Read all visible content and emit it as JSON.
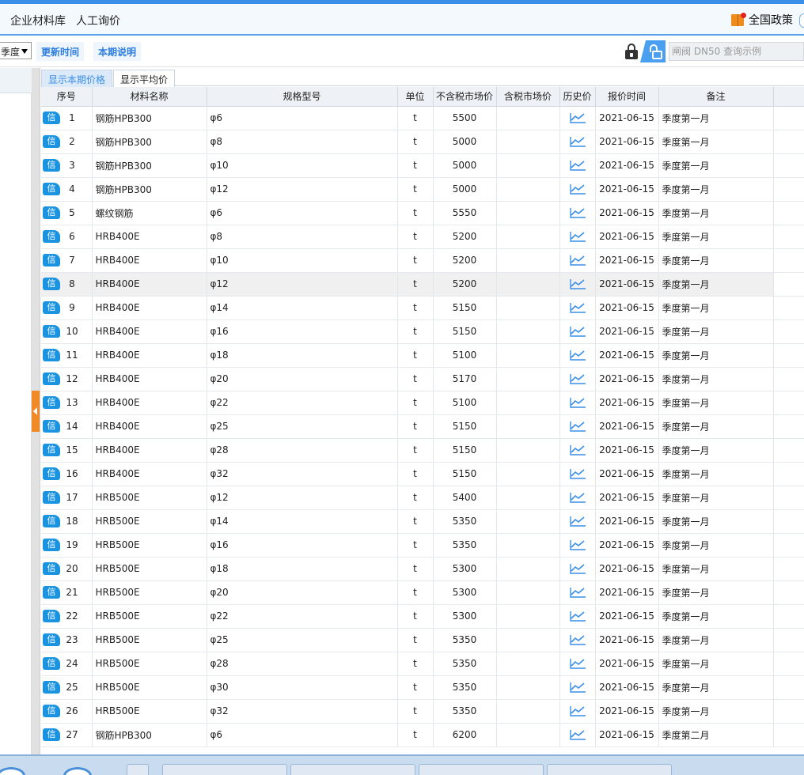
{
  "menu": {
    "item1": "企业材料库",
    "item2": "人工询价",
    "policy": "全国政策"
  },
  "toolbar": {
    "select_value": "季度",
    "update_time": "更新时间",
    "period_note": "本期说明",
    "search_placeholder": "闸阀 DN50 查询示例"
  },
  "tabs": {
    "current": "显示本期价格",
    "average": "显示平均价"
  },
  "columns": {
    "seq": "序号",
    "name": "材料名称",
    "spec": "规格型号",
    "unit": "单位",
    "price_ex": "不含税市场价",
    "price_in": "含税市场价",
    "history": "历史价",
    "date": "报价时间",
    "remark": "备注"
  },
  "badge_label": "信",
  "highlighted_row": 8,
  "rows": [
    {
      "seq": "1",
      "name": "钢筋HPB300",
      "spec": "φ6",
      "unit": "t",
      "price_ex": "5500",
      "price_in": "",
      "date": "2021-06-15",
      "remark": "季度第一月"
    },
    {
      "seq": "2",
      "name": "钢筋HPB300",
      "spec": "φ8",
      "unit": "t",
      "price_ex": "5000",
      "price_in": "",
      "date": "2021-06-15",
      "remark": "季度第一月"
    },
    {
      "seq": "3",
      "name": "钢筋HPB300",
      "spec": "φ10",
      "unit": "t",
      "price_ex": "5000",
      "price_in": "",
      "date": "2021-06-15",
      "remark": "季度第一月"
    },
    {
      "seq": "4",
      "name": "钢筋HPB300",
      "spec": "φ12",
      "unit": "t",
      "price_ex": "5000",
      "price_in": "",
      "date": "2021-06-15",
      "remark": "季度第一月"
    },
    {
      "seq": "5",
      "name": "螺纹钢筋",
      "spec": "φ6",
      "unit": "t",
      "price_ex": "5550",
      "price_in": "",
      "date": "2021-06-15",
      "remark": "季度第一月"
    },
    {
      "seq": "6",
      "name": "HRB400E",
      "spec": "φ8",
      "unit": "t",
      "price_ex": "5200",
      "price_in": "",
      "date": "2021-06-15",
      "remark": "季度第一月"
    },
    {
      "seq": "7",
      "name": "HRB400E",
      "spec": "φ10",
      "unit": "t",
      "price_ex": "5200",
      "price_in": "",
      "date": "2021-06-15",
      "remark": "季度第一月"
    },
    {
      "seq": "8",
      "name": "HRB400E",
      "spec": "φ12",
      "unit": "t",
      "price_ex": "5200",
      "price_in": "",
      "date": "2021-06-15",
      "remark": "季度第一月"
    },
    {
      "seq": "9",
      "name": "HRB400E",
      "spec": "φ14",
      "unit": "t",
      "price_ex": "5150",
      "price_in": "",
      "date": "2021-06-15",
      "remark": "季度第一月"
    },
    {
      "seq": "10",
      "name": "HRB400E",
      "spec": "φ16",
      "unit": "t",
      "price_ex": "5150",
      "price_in": "",
      "date": "2021-06-15",
      "remark": "季度第一月"
    },
    {
      "seq": "11",
      "name": "HRB400E",
      "spec": "φ18",
      "unit": "t",
      "price_ex": "5100",
      "price_in": "",
      "date": "2021-06-15",
      "remark": "季度第一月"
    },
    {
      "seq": "12",
      "name": "HRB400E",
      "spec": "φ20",
      "unit": "t",
      "price_ex": "5170",
      "price_in": "",
      "date": "2021-06-15",
      "remark": "季度第一月"
    },
    {
      "seq": "13",
      "name": "HRB400E",
      "spec": "φ22",
      "unit": "t",
      "price_ex": "5100",
      "price_in": "",
      "date": "2021-06-15",
      "remark": "季度第一月"
    },
    {
      "seq": "14",
      "name": "HRB400E",
      "spec": "φ25",
      "unit": "t",
      "price_ex": "5150",
      "price_in": "",
      "date": "2021-06-15",
      "remark": "季度第一月"
    },
    {
      "seq": "15",
      "name": "HRB400E",
      "spec": "φ28",
      "unit": "t",
      "price_ex": "5150",
      "price_in": "",
      "date": "2021-06-15",
      "remark": "季度第一月"
    },
    {
      "seq": "16",
      "name": "HRB400E",
      "spec": "φ32",
      "unit": "t",
      "price_ex": "5150",
      "price_in": "",
      "date": "2021-06-15",
      "remark": "季度第一月"
    },
    {
      "seq": "17",
      "name": "HRB500E",
      "spec": "φ12",
      "unit": "t",
      "price_ex": "5400",
      "price_in": "",
      "date": "2021-06-15",
      "remark": "季度第一月"
    },
    {
      "seq": "18",
      "name": "HRB500E",
      "spec": "φ14",
      "unit": "t",
      "price_ex": "5350",
      "price_in": "",
      "date": "2021-06-15",
      "remark": "季度第一月"
    },
    {
      "seq": "19",
      "name": "HRB500E",
      "spec": "φ16",
      "unit": "t",
      "price_ex": "5350",
      "price_in": "",
      "date": "2021-06-15",
      "remark": "季度第一月"
    },
    {
      "seq": "20",
      "name": "HRB500E",
      "spec": "φ18",
      "unit": "t",
      "price_ex": "5300",
      "price_in": "",
      "date": "2021-06-15",
      "remark": "季度第一月"
    },
    {
      "seq": "21",
      "name": "HRB500E",
      "spec": "φ20",
      "unit": "t",
      "price_ex": "5300",
      "price_in": "",
      "date": "2021-06-15",
      "remark": "季度第一月"
    },
    {
      "seq": "22",
      "name": "HRB500E",
      "spec": "φ22",
      "unit": "t",
      "price_ex": "5300",
      "price_in": "",
      "date": "2021-06-15",
      "remark": "季度第一月"
    },
    {
      "seq": "23",
      "name": "HRB500E",
      "spec": "φ25",
      "unit": "t",
      "price_ex": "5350",
      "price_in": "",
      "date": "2021-06-15",
      "remark": "季度第一月"
    },
    {
      "seq": "24",
      "name": "HRB500E",
      "spec": "φ28",
      "unit": "t",
      "price_ex": "5350",
      "price_in": "",
      "date": "2021-06-15",
      "remark": "季度第一月"
    },
    {
      "seq": "25",
      "name": "HRB500E",
      "spec": "φ30",
      "unit": "t",
      "price_ex": "5350",
      "price_in": "",
      "date": "2021-06-15",
      "remark": "季度第一月"
    },
    {
      "seq": "26",
      "name": "HRB500E",
      "spec": "φ32",
      "unit": "t",
      "price_ex": "5350",
      "price_in": "",
      "date": "2021-06-15",
      "remark": "季度第一月"
    },
    {
      "seq": "27",
      "name": "钢筋HPB300",
      "spec": "φ6",
      "unit": "t",
      "price_ex": "6200",
      "price_in": "",
      "date": "2021-06-15",
      "remark": "季度第二月"
    }
  ],
  "colors": {
    "accent": "#3a8ee6",
    "badge": "#1a93e0",
    "toolbar_btn": "#2c7de0",
    "collapse": "#f08a28",
    "policy_icon": "#f08c1c"
  },
  "icons": {
    "lock": "lock-icon",
    "unlock": "unlock-icon",
    "history": "trend-chart-icon",
    "policy": "book-icon"
  }
}
